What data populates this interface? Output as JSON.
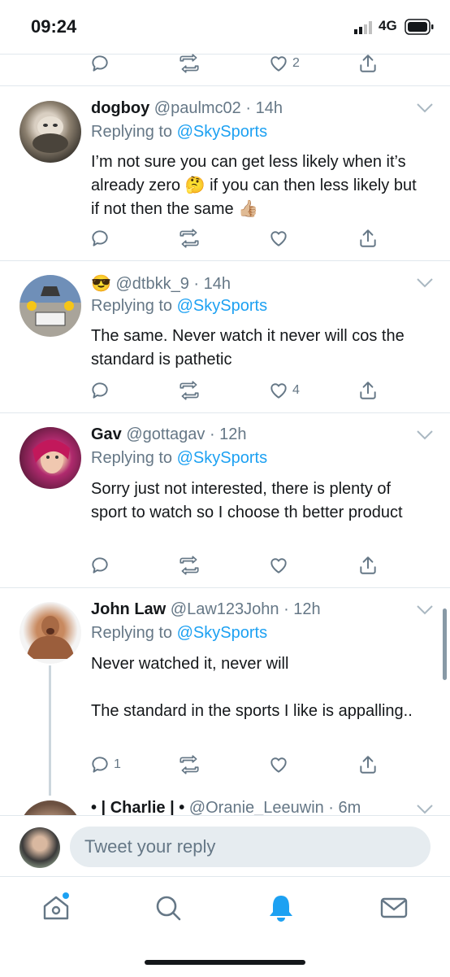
{
  "status_bar": {
    "time": "09:24",
    "network": "4G"
  },
  "top_actions": {
    "like_count": "2"
  },
  "tweets": [
    {
      "name": "dogboy",
      "handle": "@paulmc02 · 14h",
      "replying_prefix": "Replying to ",
      "replying_to": "@SkySports",
      "body": "I’m not sure you can get less likely when it’s already zero 🤔 if you can then less likely but if not then the same 👍🏼",
      "reply_count": "",
      "like_count": ""
    },
    {
      "name": "😎",
      "handle": "@dtbkk_9 · 14h",
      "replying_prefix": "Replying to ",
      "replying_to": "@SkySports",
      "body": "The same. Never watch it never will cos the standard is pathetic",
      "reply_count": "",
      "like_count": "4"
    },
    {
      "name": "Gav",
      "handle": "@gottagav · 12h",
      "replying_prefix": "Replying to ",
      "replying_to": "@SkySports",
      "body": "Sorry just not interested, there is plenty of sport to watch so I choose th better product",
      "reply_count": "",
      "like_count": ""
    },
    {
      "name": "John Law",
      "handle": "@Law123John · 12h",
      "replying_prefix": "Replying to ",
      "replying_to": "@SkySports",
      "body": "Never watched it, never will\n\nThe standard in the sports I like is appalling..",
      "reply_count": "1",
      "like_count": ""
    },
    {
      "name": "• | Charlie | •",
      "handle": "@Oranie_Leeuwin · 6m"
    }
  ],
  "composer": {
    "placeholder": "Tweet your reply"
  },
  "tabbar": {
    "items": [
      "home-icon",
      "search-icon",
      "notifications-icon",
      "messages-icon"
    ],
    "active": "notifications-icon"
  },
  "colors": {
    "accent": "#1da1f2",
    "muted": "#657786",
    "text": "#14171a"
  }
}
